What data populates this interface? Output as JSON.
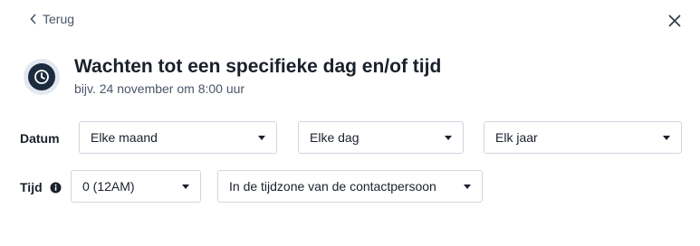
{
  "nav": {
    "back_label": "Terug"
  },
  "header": {
    "title": "Wachten tot een specifieke dag en/of tijd",
    "subtitle": "bijv. 24 november om 8:00 uur"
  },
  "date_row": {
    "label": "Datum",
    "month": "Elke maand",
    "day": "Elke dag",
    "year": "Elk jaar"
  },
  "time_row": {
    "label": "Tijd",
    "hour": "0 (12AM)",
    "timezone": "In de tijdzone van de contactpersoon"
  },
  "colors": {
    "icon_bg": "#1c2b3e",
    "icon_ring": "#e2e8f0"
  }
}
